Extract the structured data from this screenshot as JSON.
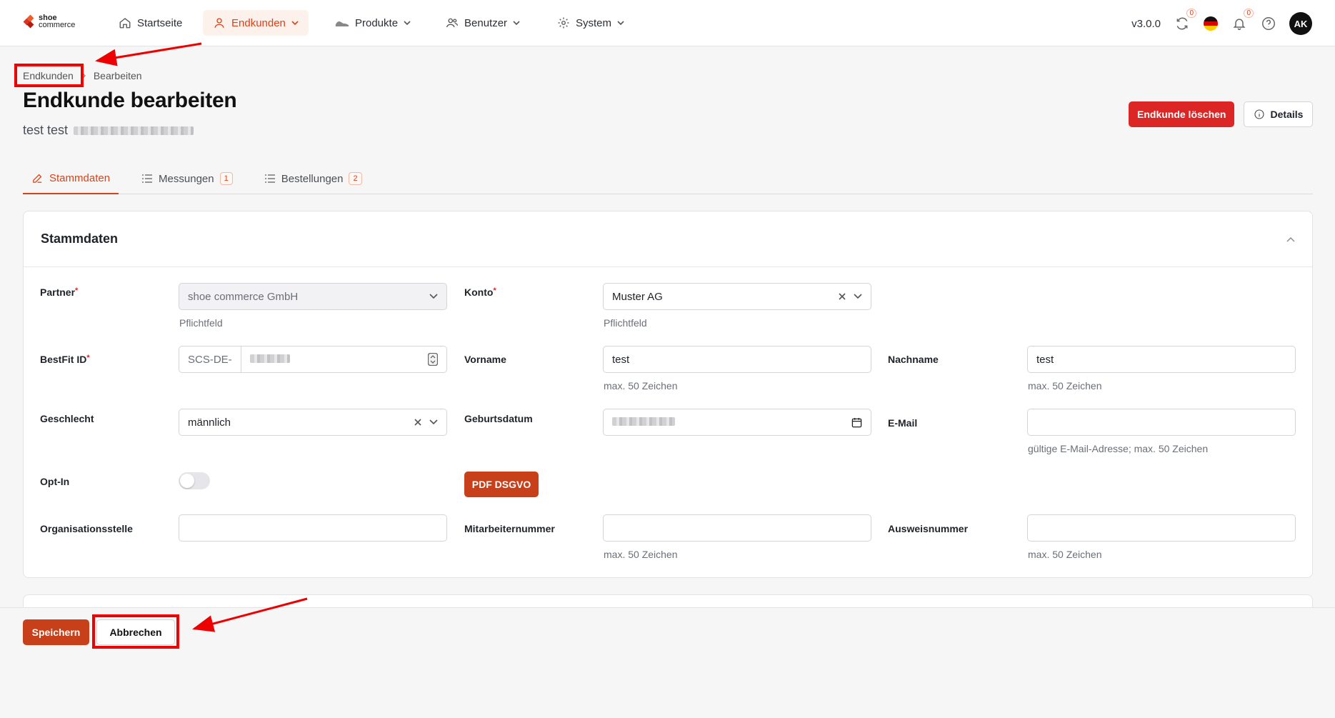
{
  "nav": {
    "logo": {
      "line1": "shoe",
      "line2": "commerce"
    },
    "items": [
      {
        "label": "Startseite",
        "icon": "home-icon"
      },
      {
        "label": "Endkunden",
        "icon": "user-icon",
        "active": true
      },
      {
        "label": "Produkte",
        "icon": "shoe-icon"
      },
      {
        "label": "Benutzer",
        "icon": "users-icon"
      },
      {
        "label": "System",
        "icon": "gear-icon"
      }
    ],
    "version": "v3.0.0",
    "sync_count": "0",
    "notification_count": "0",
    "avatar_initials": "AK"
  },
  "breadcrumb": {
    "parent": "Endkunden",
    "current": "Bearbeiten"
  },
  "page": {
    "title": "Endkunde bearbeiten",
    "subtitle": "test test",
    "delete_label": "Endkunde löschen",
    "details_label": "Details"
  },
  "tabs": [
    {
      "label": "Stammdaten",
      "icon": "edit-icon",
      "active": true
    },
    {
      "label": "Messungen",
      "count": "1",
      "icon": "list-icon"
    },
    {
      "label": "Bestellungen",
      "count": "2",
      "icon": "list-icon"
    }
  ],
  "form": {
    "section_title": "Stammdaten",
    "partner": {
      "label": "Partner",
      "value": "shoe commerce GmbH",
      "hint": "Pflichtfeld"
    },
    "konto": {
      "label": "Konto",
      "value": "Muster AG",
      "hint": "Pflichtfeld"
    },
    "bestfit": {
      "label": "BestFit ID",
      "prefix": "SCS-DE-"
    },
    "vorname": {
      "label": "Vorname",
      "value": "test",
      "hint": "max. 50 Zeichen"
    },
    "nachname": {
      "label": "Nachname",
      "value": "test",
      "hint": "max. 50 Zeichen"
    },
    "geschlecht": {
      "label": "Geschlecht",
      "value": "männlich"
    },
    "geburtsdatum": {
      "label": "Geburtsdatum"
    },
    "email": {
      "label": "E-Mail",
      "value": "",
      "hint": "gültige E-Mail-Adresse; max. 50 Zeichen"
    },
    "optin": {
      "label": "Opt-In",
      "checked": false
    },
    "pdf_label": "PDF DSGVO",
    "organisation": {
      "label": "Organisationsstelle",
      "value": ""
    },
    "mitarbeiter": {
      "label": "Mitarbeiternummer",
      "value": "",
      "hint": "max. 50 Zeichen"
    },
    "ausweis": {
      "label": "Ausweisnummer",
      "value": "",
      "hint": "max. 50 Zeichen"
    }
  },
  "footer": {
    "save_label": "Speichern",
    "cancel_label": "Abbrechen"
  },
  "colors": {
    "accent": "#d8421a",
    "danger": "#dc2626",
    "annotation": "#ee0000"
  }
}
